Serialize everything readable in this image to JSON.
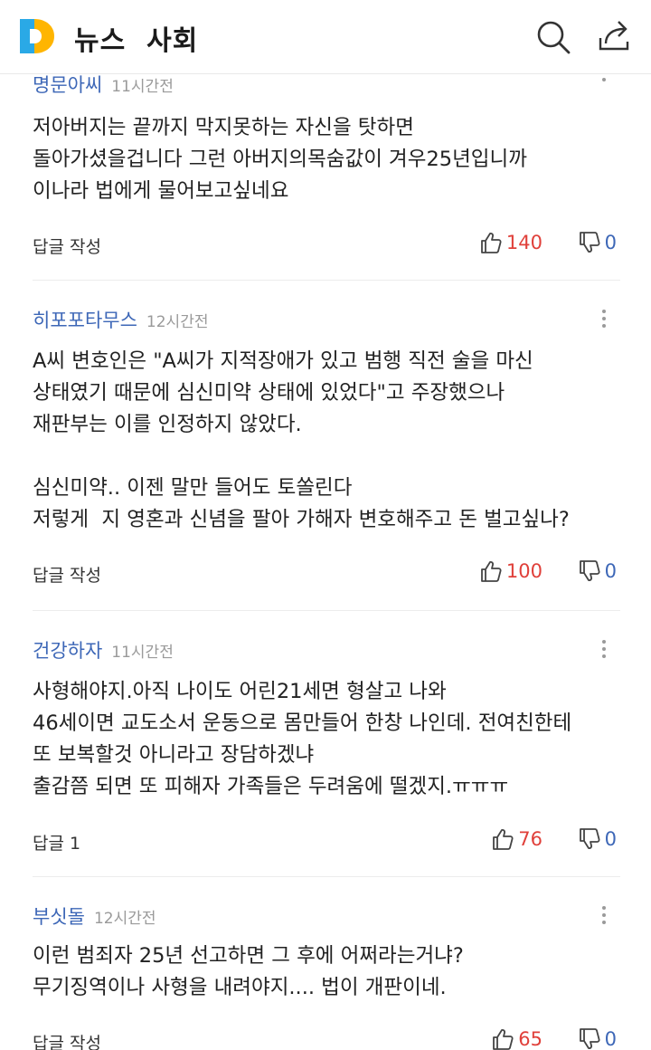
{
  "header": {
    "title": "뉴스  사회",
    "logo_colors": {
      "left": "#2aa9e6",
      "right": "#ffb500"
    }
  },
  "comments": [
    {
      "author": "명문아씨",
      "time": "11시간전",
      "lines": [
        "저아버지는 끝까지 막지못하는 자신을 탓하면",
        "돌아가셨을겁니다 그런 아버지의목숨값이 겨우25년입니까",
        "이나라 법에게 물어보고싶네요"
      ],
      "reply_label": "답글 작성",
      "likes": "140",
      "dislikes": "0"
    },
    {
      "author": "히포포타무스",
      "time": "12시간전",
      "lines": [
        "A씨 변호인은 \"A씨가 지적장애가 있고 범행 직전 술을 마신",
        "상태였기 때문에 심신미약 상태에 있었다\"고 주장했으나",
        "재판부는 이를 인정하지 않았다.",
        "",
        "심신미약.. 이젠 말만 들어도 토쏠린다",
        "저렇게  지 영혼과 신념을 팔아 가해자 변호해주고 돈 벌고싶나?"
      ],
      "reply_label": "답글 작성",
      "likes": "100",
      "dislikes": "0"
    },
    {
      "author": "건강하자",
      "time": "11시간전",
      "lines": [
        "사형해야지.아직 나이도 어린21세면 형살고 나와",
        "46세이면 교도소서 운동으로 몸만들어 한창 나인데. 전여친한테",
        "또 보복할것 아니라고 장담하겠냐",
        "출감쯤 되면 또 피해자 가족들은 두려움에 떨겠지.ㅠㅠㅠ"
      ],
      "reply_label": "답글 1",
      "likes": "76",
      "dislikes": "0"
    },
    {
      "author": "부싯돌",
      "time": "12시간전",
      "lines": [
        "이런 범죄자 25년 선고하면 그 후에 어쩌라는거냐?",
        "무기징역이나 사형을 내려야지.... 법이 개판이네."
      ],
      "reply_label": "답글 작성",
      "likes": "65",
      "dislikes": "0"
    }
  ]
}
